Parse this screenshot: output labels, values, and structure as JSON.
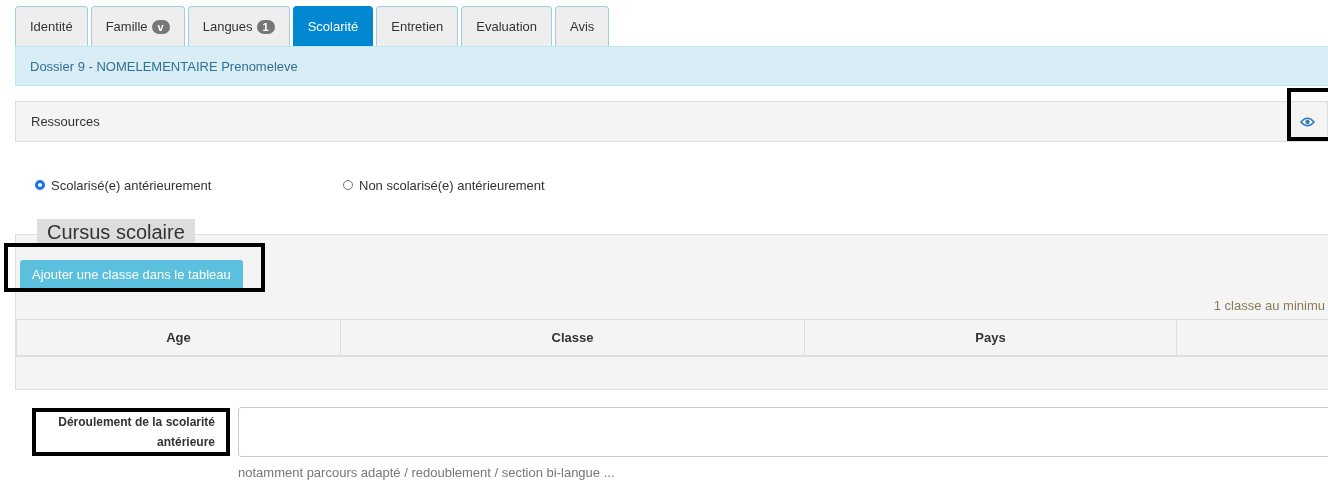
{
  "tabs": [
    {
      "label": "Identité",
      "selected": false
    },
    {
      "label": "Famille",
      "badge": "v",
      "selected": false
    },
    {
      "label": "Langues",
      "badge": "1",
      "selected": false
    },
    {
      "label": "Scolarité",
      "selected": true
    },
    {
      "label": "Entretien",
      "selected": false
    },
    {
      "label": "Evaluation",
      "selected": false
    },
    {
      "label": "Avis",
      "selected": false
    }
  ],
  "dossier": "Dossier 9 - NOMELEMENTAIRE Prenomeleve",
  "ressources": {
    "title": "Ressources",
    "highlighted": true
  },
  "radios": [
    {
      "label": "Scolarisé(e) antérieurement",
      "selected": true
    },
    {
      "label": "Non scolarisé(e) antérieurement",
      "selected": false
    }
  ],
  "cursus": {
    "legend": "Cursus scolaire",
    "add_button": {
      "label": "Ajouter une classe dans le tableau",
      "highlighted": true
    },
    "hint": "1 classe au minimu",
    "table": {
      "columns": [
        "Age",
        "Classe",
        "Pays",
        ""
      ]
    }
  },
  "deroulement": {
    "label": "Déroulement de la scolarité antérieure",
    "highlighted": true,
    "help": "notamment parcours adapté / redoublement / section bi-langue ..."
  }
}
